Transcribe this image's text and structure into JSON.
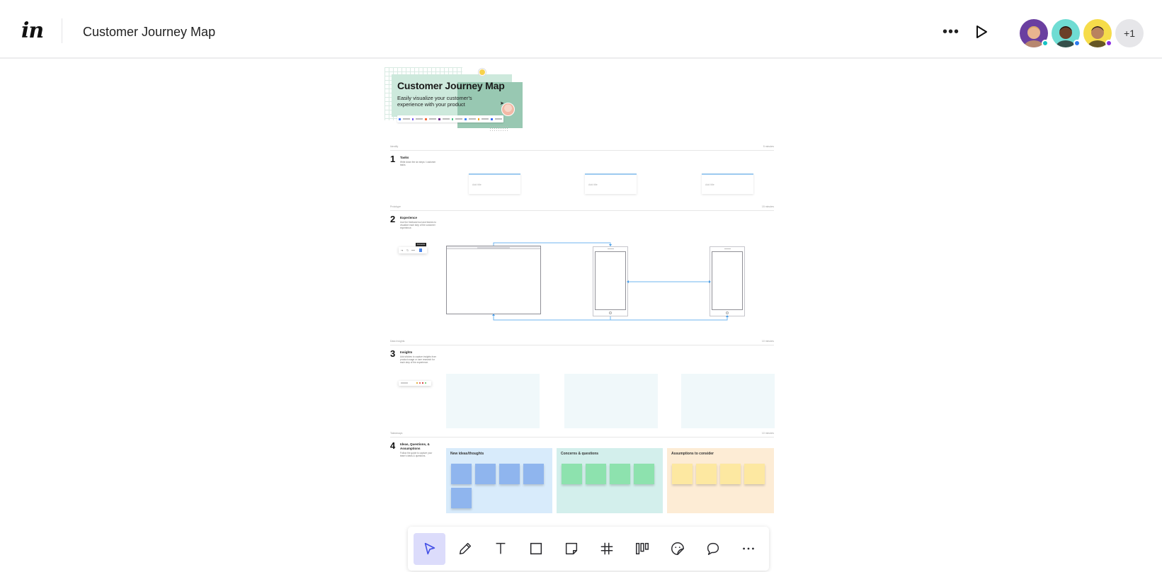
{
  "header": {
    "logo": "in",
    "title": "Customer Journey Map",
    "more_icon": "more-horizontal-icon",
    "play_icon": "play-icon",
    "collaborators": [
      {
        "name": "collaborator-1",
        "bg": "#6a3fa0",
        "skin": "#e9b58f",
        "hair": "#d8a75a",
        "status": "#15c3c3"
      },
      {
        "name": "collaborator-2",
        "bg": "#6fdcd3",
        "skin": "#6b3f28",
        "hair": "#1c1210",
        "status": "#2b7bf0"
      },
      {
        "name": "collaborator-3",
        "bg": "#f6dc4a",
        "skin": "#b9835e",
        "hair": "#2a1d16",
        "status": "#8a2be2"
      }
    ],
    "extra_count": "+1"
  },
  "board": {
    "hero": {
      "title": "Customer Journey Map",
      "subtitle": "Easily visualize your customer's experience with your product",
      "integrations": [
        "#4f7ef5",
        "#7a5cf0",
        "#f36b3b",
        "#6d2c8e",
        "#4cc38a",
        "#4285f4",
        "#f3a122",
        "#3b6bf5"
      ]
    },
    "sections": [
      {
        "label": "Identify",
        "time": "5 minutes",
        "number": "1",
        "title": "Tasks",
        "desc": "Write down the six steps / customer tasks."
      },
      {
        "label": "Prototype",
        "time": "15 minutes",
        "number": "2",
        "title": "Experience",
        "desc": "Use the freehand tool and frames to visualize each step of the customer experience."
      },
      {
        "label": "Data Insights",
        "time": "10 minutes",
        "number": "3",
        "title": "Insights",
        "desc": "Add stickies to capture insights from product usage or user research for each step of the experience."
      },
      {
        "label": "Takeaways",
        "time": "10 minutes",
        "number": "4",
        "title": "Ideas, Questions, & Assumptions",
        "desc": "Follow the guide to capture your team's ideas & questions."
      }
    ],
    "task_cards": [
      "Add title",
      "Add title",
      "Add title"
    ],
    "step_tooltip": "Connector",
    "clusters": [
      {
        "title": "New ideas/thoughts",
        "bg": "#d8ebfb",
        "sticky": "#8fb5ee",
        "count": 5
      },
      {
        "title": "Concerns & questions",
        "bg": "#d3efec",
        "sticky": "#8de2ae",
        "count": 4
      },
      {
        "title": "Assumptions to consider",
        "bg": "#fdecd5",
        "sticky": "#fde8a1",
        "count": 4
      }
    ]
  },
  "toolbar": {
    "tools": [
      {
        "name": "select-tool",
        "icon": "cursor-icon",
        "active": true
      },
      {
        "name": "pen-tool",
        "icon": "pencil-icon",
        "active": false
      },
      {
        "name": "text-tool",
        "icon": "text-icon",
        "active": false
      },
      {
        "name": "shape-tool",
        "icon": "square-icon",
        "active": false
      },
      {
        "name": "sticky-note-tool",
        "icon": "sticky-note-icon",
        "active": false
      },
      {
        "name": "frame-tool",
        "icon": "hash-icon",
        "active": false
      },
      {
        "name": "layout-tool",
        "icon": "columns-icon",
        "active": false
      },
      {
        "name": "sticker-tool",
        "icon": "sticker-icon",
        "active": false
      },
      {
        "name": "comment-tool",
        "icon": "comment-icon",
        "active": false
      },
      {
        "name": "more-tools",
        "icon": "more-horizontal-icon",
        "active": false
      }
    ],
    "active_color": "#4450e6"
  }
}
